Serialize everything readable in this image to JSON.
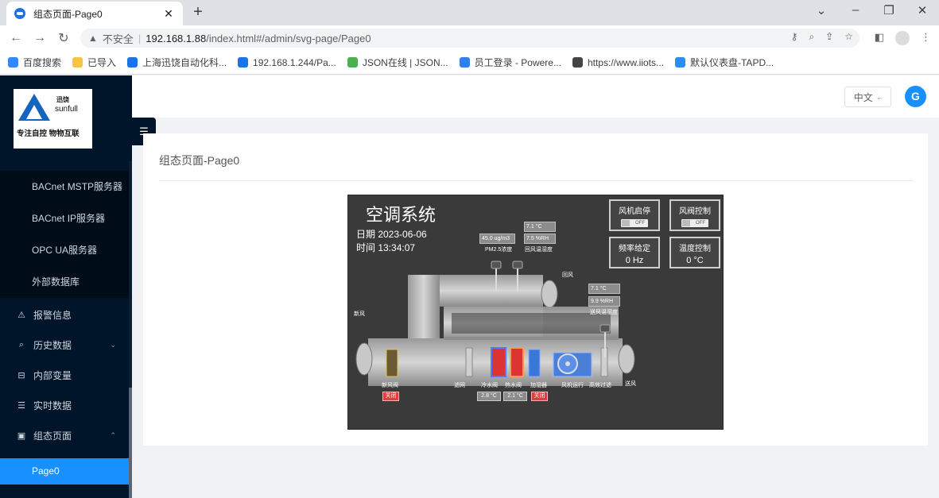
{
  "browser": {
    "tab_title": "组态页面-Page0",
    "close_glyph": "✕",
    "new_tab_glyph": "+",
    "url_security": "不安全",
    "url_host": "192.168.1.88",
    "url_path": "/index.html#/admin/svg-page/Page0",
    "bookmarks": [
      {
        "label": "百度搜索",
        "color": "#3388ff"
      },
      {
        "label": "已导入",
        "color": "#f6c343"
      },
      {
        "label": "上海迅饶自动化科...",
        "color": "#1a73e8"
      },
      {
        "label": "192.168.1.244/Pa...",
        "color": "#1a73e8"
      },
      {
        "label": "JSON在线 | JSON...",
        "color": "#4caf50"
      },
      {
        "label": "员工登录 - Powere...",
        "color": "#2f80ed"
      },
      {
        "label": "https://www.iiots...",
        "color": "#444444"
      },
      {
        "label": "默认仪表盘-TAPD...",
        "color": "#2d8cf0"
      }
    ]
  },
  "sidebar": {
    "logo": {
      "cn": "迅饶",
      "en": "sunfull",
      "slogan": "专注自控 物物互联"
    },
    "sub_items": [
      "BACnet MSTP服务器",
      "BACnet IP服务器",
      "OPC UA服务器",
      "外部数据库"
    ],
    "menu": [
      {
        "icon": "⚠",
        "label": "报警信息",
        "arrow": ""
      },
      {
        "icon": "⌕",
        "label": "历史数据",
        "arrow": "⌄"
      },
      {
        "icon": "⊟",
        "label": "内部变量",
        "arrow": ""
      },
      {
        "icon": "☰",
        "label": "实时数据",
        "arrow": ""
      },
      {
        "icon": "▣",
        "label": "组态页面",
        "arrow": "⌃"
      }
    ],
    "active_item": "Page0"
  },
  "header": {
    "language": "中文",
    "user_initial": "G"
  },
  "content": {
    "title": "组态页面-Page0"
  },
  "scada": {
    "title": "空调系统",
    "date_line": "日期 2023-06-06",
    "time_line": "时间 13:34:07",
    "controls": {
      "fan_start_stop": {
        "label": "风机启停",
        "toggle": "OFF"
      },
      "damper_control": {
        "label": "风阀控制",
        "toggle": "OFF"
      },
      "freq_setpoint": {
        "label": "频率给定",
        "value": "0 Hz"
      },
      "temp_control": {
        "label": "温度控制",
        "value": "0 °C"
      }
    },
    "pm25": {
      "value": "45.0 ug/m3",
      "label": "PM2.5浓度"
    },
    "return_air": {
      "temp": "7.1 °C",
      "humidity": "7.5 %RH",
      "label": "回风温湿度",
      "duct_label": "回风"
    },
    "supply_air": {
      "temp": "7.1 °C",
      "humidity": "9.9 %RH",
      "label": "送风温湿度",
      "duct_label": "送风"
    },
    "fresh_air_label": "新风",
    "components": [
      "新风阀",
      "滤网",
      "冷水阀",
      "热水阀",
      "加湿器",
      "风机运行",
      "高效过滤"
    ],
    "fresh_damper_status": "关闭",
    "cold_valve_temp": "2.8 °C",
    "hot_valve_temp": "2.1 °C",
    "humidifier_status": "关闭",
    "colors": {
      "panel": "#3a3a3a",
      "duct": "#b5b5b5",
      "cold_coil": "#d33",
      "hot_coil": "#d33",
      "humidifier": "#3a78d8",
      "fan": "#4a7fd8"
    }
  }
}
